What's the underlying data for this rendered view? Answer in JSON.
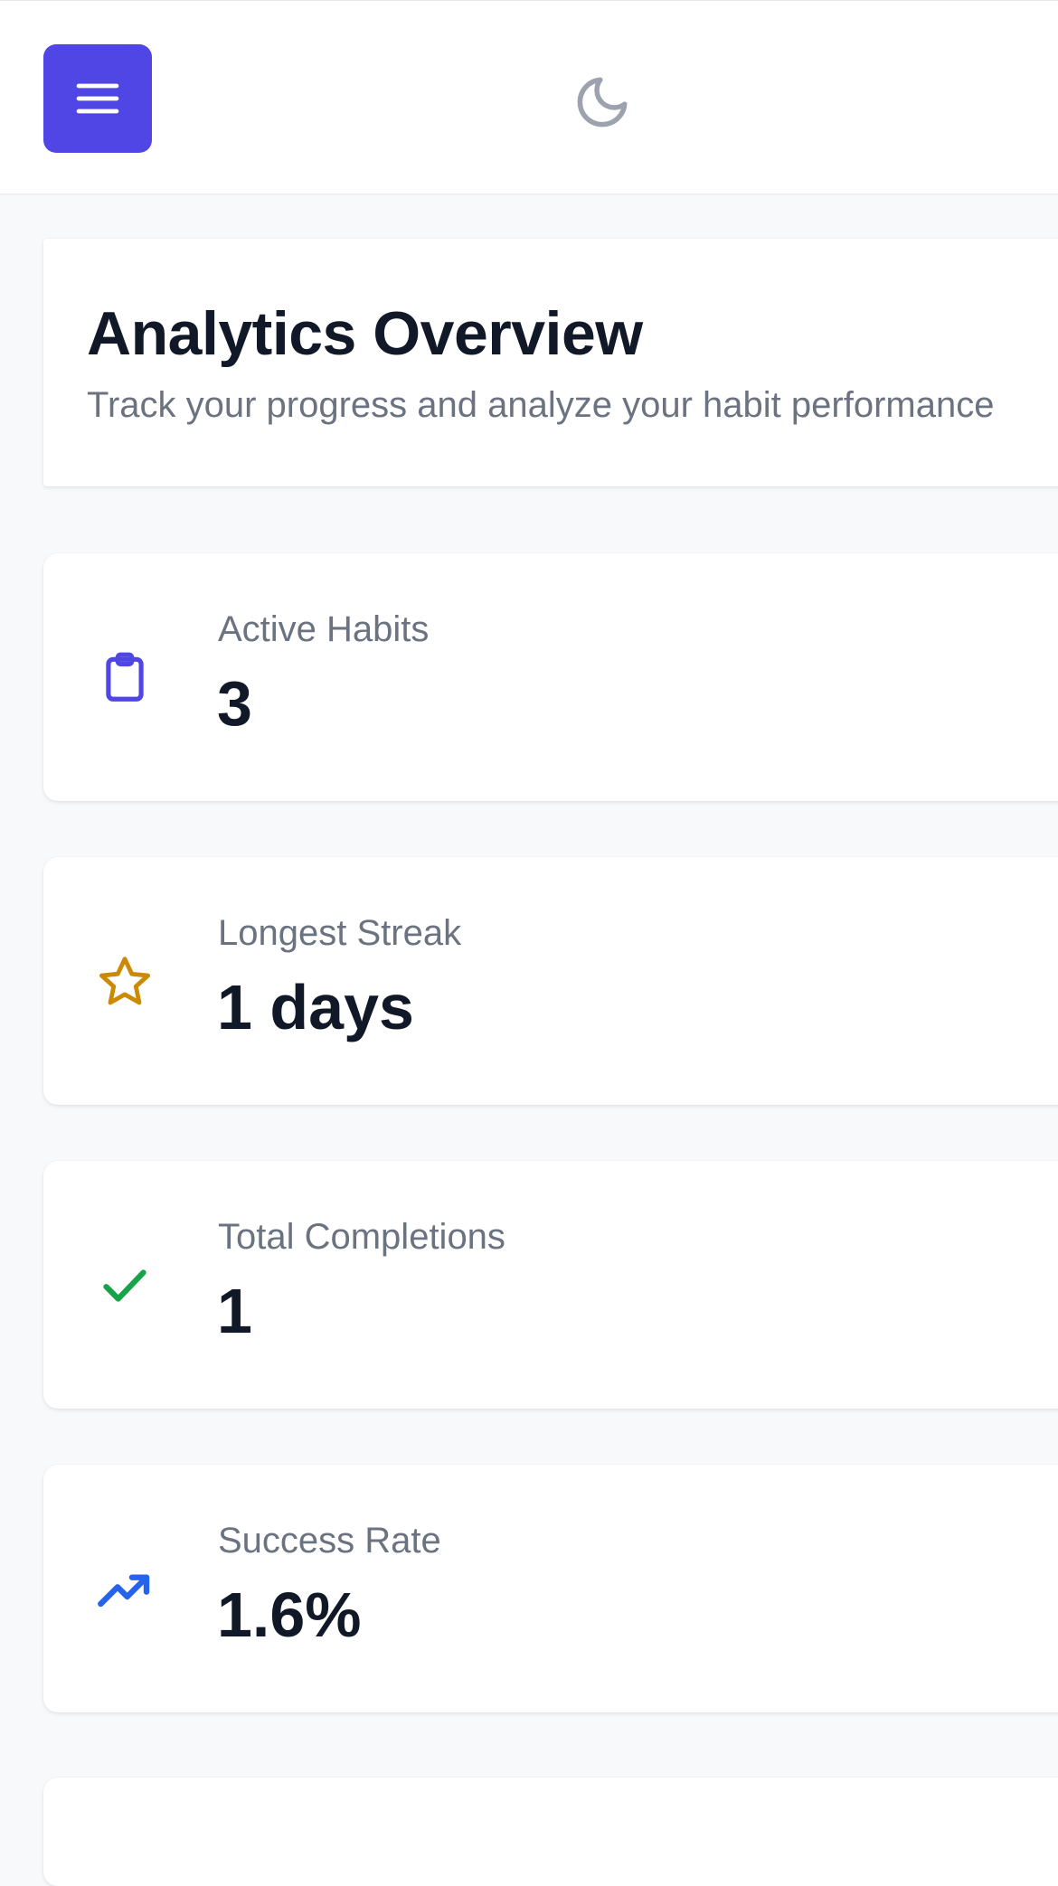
{
  "topbar": {
    "menu_icon": "hamburger-menu-icon",
    "theme_icon": "moon-icon",
    "accent_color": "#4f46e5"
  },
  "header": {
    "title": "Analytics Overview",
    "subtitle": "Track your progress and analyze your habit performance"
  },
  "stats": [
    {
      "label": "Active Habits",
      "value": "3",
      "icon": "clipboard-icon",
      "color": "#4f46e5"
    },
    {
      "label": "Longest Streak",
      "value": "1 days",
      "icon": "star-icon",
      "color": "#ca8a04"
    },
    {
      "label": "Total Completions",
      "value": "1",
      "icon": "check-icon",
      "color": "#16a34a"
    },
    {
      "label": "Success Rate",
      "value": "1.6%",
      "icon": "trending-up-icon",
      "color": "#2563eb"
    }
  ]
}
